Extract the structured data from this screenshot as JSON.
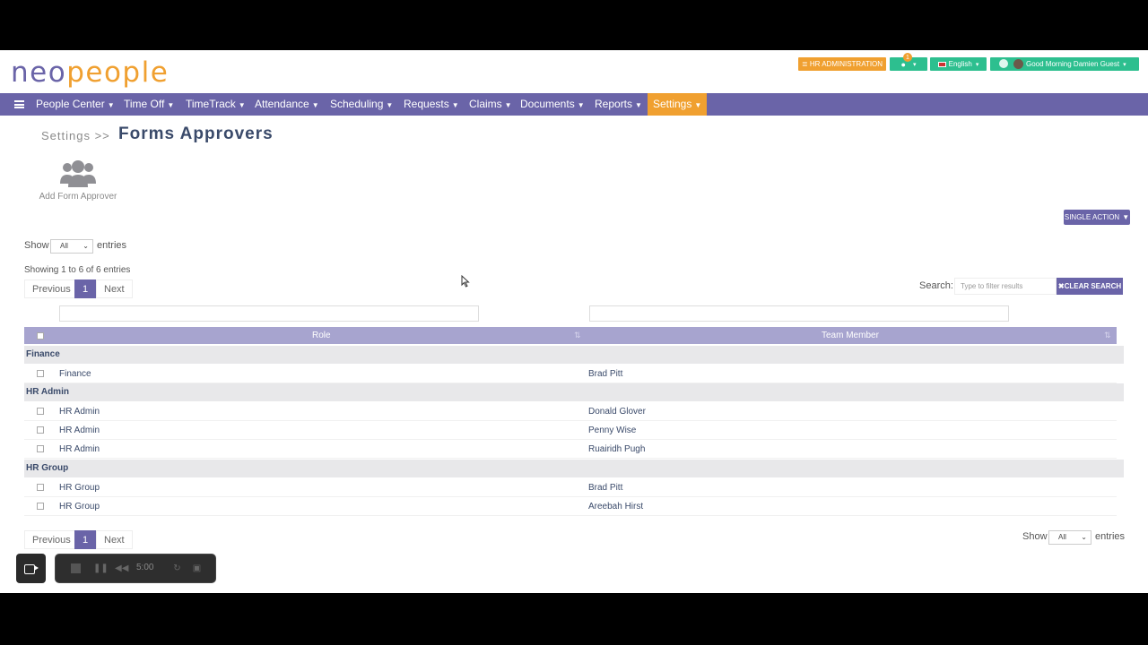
{
  "header": {
    "logo_neo": "neo",
    "logo_people": "people",
    "hr_admin_label": "≣ HR ADMINISTRATION",
    "notif_count": "1",
    "language_label": "English",
    "greeting": "Good Morning Damien Guest"
  },
  "nav": {
    "items": [
      {
        "label": "People Center"
      },
      {
        "label": "Time Off"
      },
      {
        "label": "TimeTrack"
      },
      {
        "label": "Attendance"
      },
      {
        "label": "Scheduling"
      },
      {
        "label": "Requests"
      },
      {
        "label": "Claims"
      },
      {
        "label": "Documents"
      },
      {
        "label": "Reports"
      },
      {
        "label": "Settings"
      }
    ],
    "active": "Settings"
  },
  "page": {
    "breadcrumb": "Settings >>",
    "title": "Forms Approvers",
    "add_label": "Add Form Approver",
    "single_action_label": "SINGLE ACTION"
  },
  "table_controls": {
    "show_label": "Show",
    "entries_label": "entries",
    "show_value": "All",
    "showing_text": "Showing 1 to 6 of 6 entries",
    "previous": "Previous",
    "page": "1",
    "next": "Next",
    "search_label": "Search:",
    "search_placeholder": "Type to filter results",
    "clear_search": "✖CLEAR SEARCH"
  },
  "table": {
    "columns": [
      "Role",
      "Team Member"
    ],
    "groups": [
      {
        "name": "Finance",
        "rows": [
          {
            "role": "Finance",
            "member": "Brad Pitt"
          }
        ]
      },
      {
        "name": "HR Admin",
        "rows": [
          {
            "role": "HR Admin",
            "member": "Donald Glover"
          },
          {
            "role": "HR Admin",
            "member": "Penny Wise"
          },
          {
            "role": "HR Admin",
            "member": "Ruairidh Pugh"
          }
        ]
      },
      {
        "name": "HR Group",
        "rows": [
          {
            "role": "HR Group",
            "member": "Brad Pitt"
          },
          {
            "role": "HR Group",
            "member": "Areebah Hirst"
          }
        ]
      }
    ]
  },
  "recorder": {
    "timer": "5:00"
  },
  "colors": {
    "brand_purple": "#6a64a8",
    "brand_orange": "#f0a030",
    "accent_green": "#2dbf8f"
  }
}
